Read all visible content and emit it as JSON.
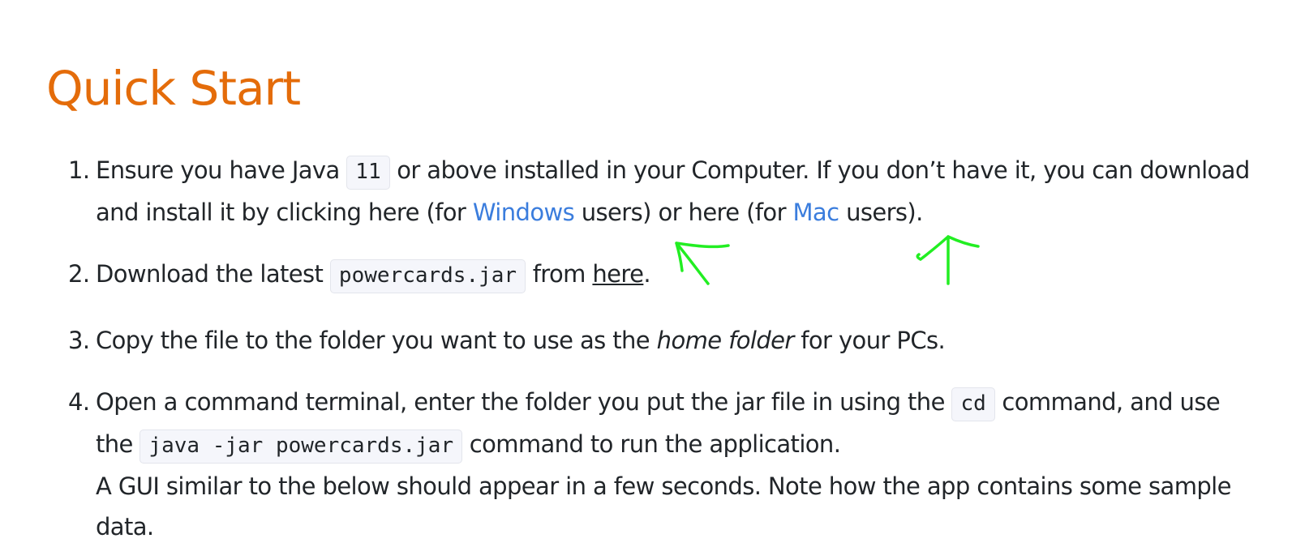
{
  "heading": "Quick Start",
  "steps": {
    "s1": {
      "num": "1.",
      "t1": "Ensure you have Java ",
      "code1": "11",
      "t2": " or above installed in your Computer. If you don’t have it, you can download and install it by clicking here (for ",
      "link_windows": "Windows",
      "t3": " users) or here (for ",
      "link_mac": "Mac",
      "t4": " users)."
    },
    "s2": {
      "num": "2.",
      "t1": "Download the latest ",
      "code1": "powercards.jar",
      "t2": " from ",
      "link_here": "here",
      "t3": "."
    },
    "s3": {
      "num": "3.",
      "t1": "Copy the file to the folder you want to use as the ",
      "em1": "home folder",
      "t2": " for your PCs."
    },
    "s4": {
      "num": "4.",
      "t1": "Open a command terminal, enter the folder you put the jar file in using the ",
      "code1": "cd",
      "t2": " command, and use the ",
      "code2": "java -jar powercards.jar",
      "t3": " command to run the application.",
      "t4": "A GUI similar to the below should appear in a few seconds. Note how the app contains some sample data."
    }
  },
  "colors": {
    "heading": "#e46c0a",
    "link": "#3b7ddd",
    "annotation": "#22ee22"
  },
  "annotations": [
    "arrow-pointing-to-windows-link",
    "arrow-pointing-to-mac-link"
  ]
}
